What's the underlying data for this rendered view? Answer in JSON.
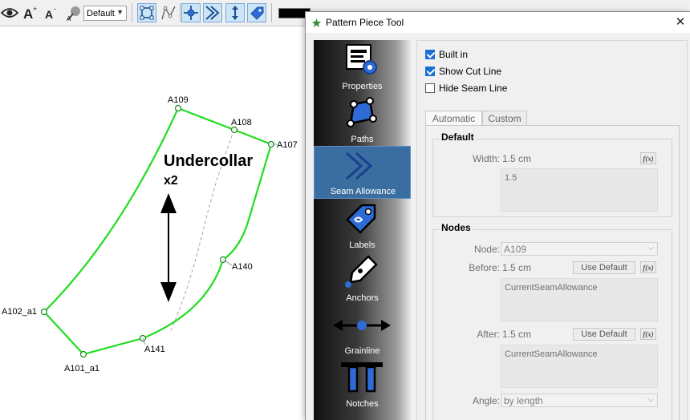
{
  "toolbar": {
    "style_combo": "Default",
    "color_swatch": "#000000"
  },
  "canvas": {
    "piece_name_line1": "Undercollar",
    "piece_name_line2": "x2",
    "points": {
      "A109": "A109",
      "A108": "A108",
      "A107": "A107",
      "A140": "A140",
      "A141": "A141",
      "A101_a1": "A101_a1",
      "A102_a1": "A102_a1"
    },
    "seam_color": "#22dd22"
  },
  "dialog": {
    "title": "Pattern Piece Tool",
    "sidebar": {
      "items": [
        {
          "label": "Properties",
          "icon": "properties-icon"
        },
        {
          "label": "Paths",
          "icon": "paths-icon"
        },
        {
          "label": "Seam Allowance",
          "icon": "seam-allowance-icon"
        },
        {
          "label": "Labels",
          "icon": "labels-icon"
        },
        {
          "label": "Anchors",
          "icon": "anchors-icon"
        },
        {
          "label": "Grainline",
          "icon": "grainline-icon"
        },
        {
          "label": "Notches",
          "icon": "notches-icon"
        }
      ],
      "active": "Seam Allowance"
    },
    "checkboxes": {
      "built_in": {
        "label": "Built in",
        "checked": true
      },
      "show_cut_line": {
        "label": "Show Cut Line",
        "checked": true
      },
      "hide_seam_line": {
        "label": "Hide Seam Line",
        "checked": false
      }
    },
    "tabs": [
      "Automatic",
      "Custom"
    ],
    "default_group": {
      "title": "Default",
      "width_label": "Width:",
      "width_value": "1.5 cm",
      "width_formula": "1.5"
    },
    "nodes_group": {
      "title": "Nodes",
      "node_label": "Node:",
      "node_value": "A109",
      "before_label": "Before:",
      "before_value": "1.5 cm",
      "before_formula": "CurrentSeamAllowance",
      "after_label": "After:",
      "after_value": "1.5 cm",
      "after_formula": "CurrentSeamAllowance",
      "use_default": "Use Default",
      "angle_label": "Angle:",
      "angle_value": "by length"
    },
    "fx_label": "f(x)"
  }
}
